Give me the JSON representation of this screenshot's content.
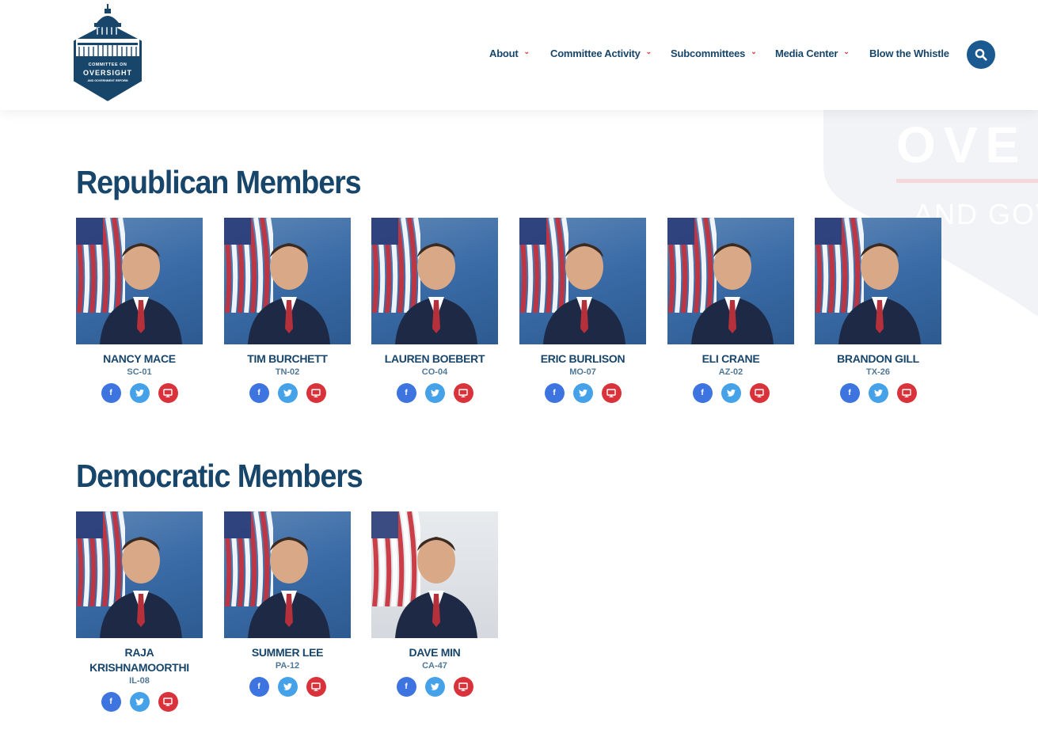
{
  "logo": {
    "line1": "COMMITTEE ON",
    "line2": "OVERSIGHT",
    "line3": "AND GOVERNMENT REFORM"
  },
  "watermark": {
    "line1": "OVE",
    "line2": "AND GOV"
  },
  "nav": [
    {
      "label": "About",
      "has_dropdown": true
    },
    {
      "label": "Committee Activity",
      "has_dropdown": true
    },
    {
      "label": "Subcommittees",
      "has_dropdown": true
    },
    {
      "label": "Media Center",
      "has_dropdown": true
    },
    {
      "label": "Blow the Whistle",
      "has_dropdown": false
    }
  ],
  "search": {
    "icon": "search-icon"
  },
  "colors": {
    "navy": "#18466b",
    "accent_red": "#d9383f",
    "facebook": "#3d74e0",
    "twitter": "#46a2e8",
    "website": "#d9323a"
  },
  "sections": {
    "republican": {
      "title": "Republican Members",
      "members": [
        {
          "name": "NANCY MACE",
          "district": "SC-01"
        },
        {
          "name": "TIM BURCHETT",
          "district": "TN-02"
        },
        {
          "name": "LAUREN BOEBERT",
          "district": "CO-04"
        },
        {
          "name": "ERIC BURLISON",
          "district": "MO-07"
        },
        {
          "name": "ELI CRANE",
          "district": "AZ-02"
        },
        {
          "name": "BRANDON GILL",
          "district": "TX-26"
        }
      ]
    },
    "democratic": {
      "title": "Democratic Members",
      "members": [
        {
          "name": "RAJA KRISHNAMOORTHI",
          "district": "IL-08"
        },
        {
          "name": "SUMMER LEE",
          "district": "PA-12"
        },
        {
          "name": "DAVE MIN",
          "district": "CA-47"
        }
      ]
    }
  }
}
